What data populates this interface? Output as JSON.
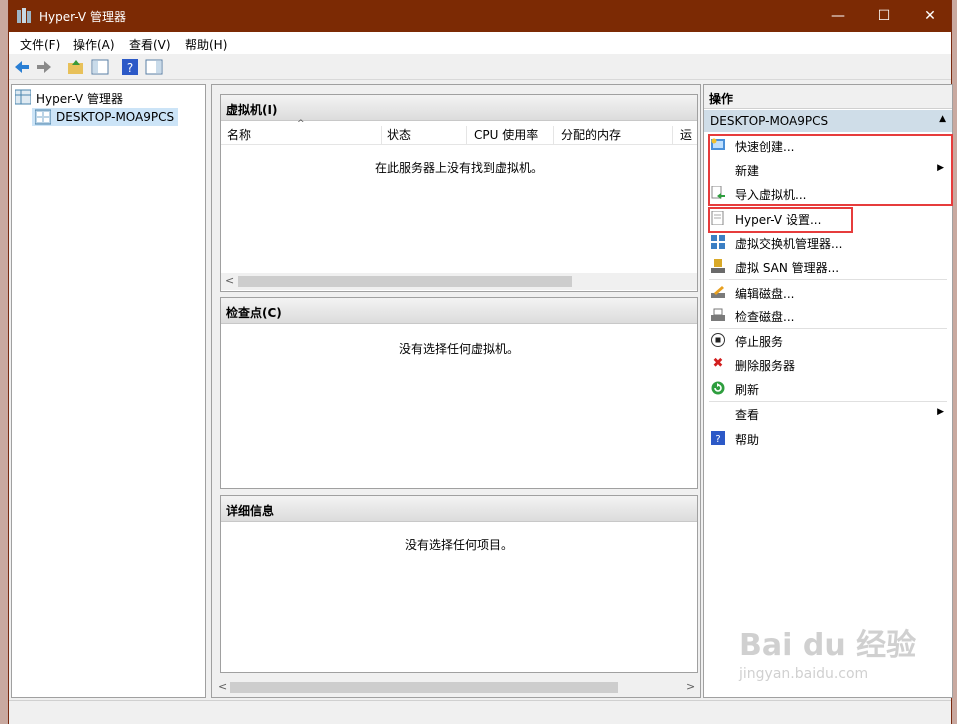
{
  "window": {
    "title": "Hyper-V 管理器",
    "minimize": "—",
    "maximize": "☐",
    "close": "✕"
  },
  "menu": [
    "文件(F)",
    "操作(A)",
    "查看(V)",
    "帮助(H)"
  ],
  "tree": {
    "root": "Hyper-V 管理器",
    "server": "DESKTOP-MOA9PCS"
  },
  "vm_panel": {
    "title": "虚拟机(I)",
    "columns": [
      "名称",
      "状态",
      "CPU 使用率",
      "分配的内存",
      "运行"
    ],
    "empty": "在此服务器上没有找到虚拟机。"
  },
  "checkpoint_panel": {
    "title": "检查点(C)",
    "empty": "没有选择任何虚拟机。"
  },
  "details_panel": {
    "title": "详细信息",
    "empty": "没有选择任何项目。"
  },
  "actions": {
    "header": "操作",
    "section": "DESKTOP-MOA9PCS",
    "items": [
      {
        "label": "快速创建...",
        "icon": "quick-create-icon"
      },
      {
        "label": "新建",
        "icon": "none",
        "submenu": true
      },
      {
        "label": "导入虚拟机...",
        "icon": "import-icon"
      },
      {
        "label": "Hyper-V 设置...",
        "icon": "settings-doc-icon"
      },
      {
        "label": "虚拟交换机管理器...",
        "icon": "switch-icon"
      },
      {
        "label": "虚拟 SAN 管理器...",
        "icon": "san-icon"
      },
      {
        "label": "编辑磁盘...",
        "icon": "edit-disk-icon"
      },
      {
        "label": "检查磁盘...",
        "icon": "inspect-disk-icon"
      },
      {
        "label": "停止服务",
        "icon": "stop-icon"
      },
      {
        "label": "删除服务器",
        "icon": "delete-icon"
      },
      {
        "label": "刷新",
        "icon": "refresh-icon"
      },
      {
        "label": "查看",
        "icon": "none",
        "submenu": true
      },
      {
        "label": "帮助",
        "icon": "help-icon"
      }
    ]
  },
  "watermark": {
    "main": "Bai du 经验",
    "sub": "jingyan.baidu.com"
  },
  "colors": {
    "titlebar": "#7c2a04",
    "highlight_box": "#e63c3c",
    "section_bg": "#cfdde8"
  }
}
